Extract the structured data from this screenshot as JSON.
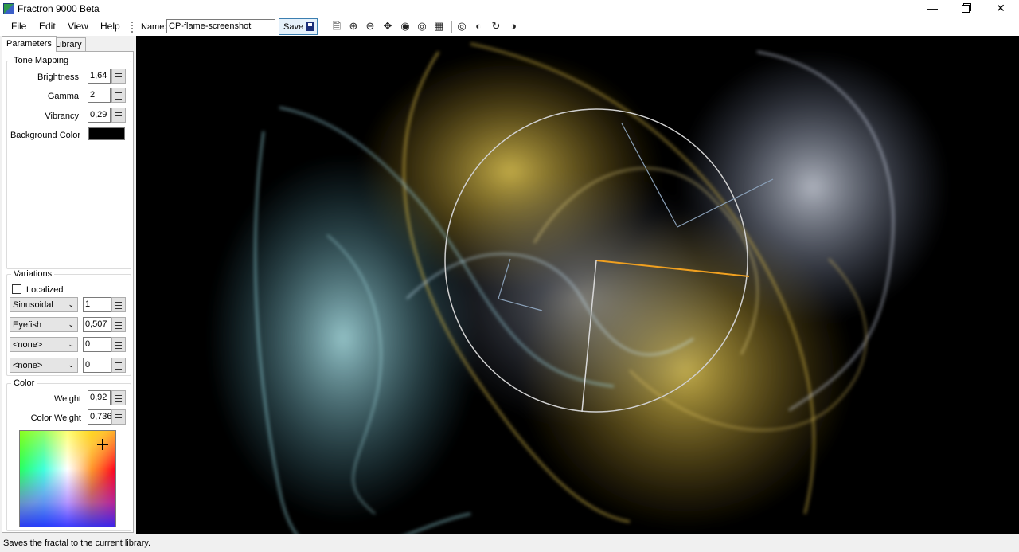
{
  "window": {
    "title": "Fractron 9000 Beta"
  },
  "menu": {
    "file": "File",
    "edit": "Edit",
    "view": "View",
    "help": "Help"
  },
  "toolbar": {
    "name_label": "Name:",
    "name_value": "CP-flame-screenshot",
    "save_label": "Save",
    "icons": [
      "new-file-icon",
      "zoom-in-icon",
      "zoom-out-icon",
      "center-icon",
      "view-icon",
      "view-alt-icon",
      "randomize-icon",
      "add-transform-icon",
      "remove-transform-icon",
      "rotate-icon",
      "copy-transform-icon"
    ]
  },
  "tabs": {
    "parameters": "Parameters",
    "library": "Library"
  },
  "tone_mapping": {
    "title": "Tone Mapping",
    "brightness_label": "Brightness",
    "brightness": "1,64",
    "gamma_label": "Gamma",
    "gamma": "2",
    "vibrancy_label": "Vibrancy",
    "vibrancy": "0,29",
    "background_label": "Background Color",
    "background_color": "#000000"
  },
  "variations": {
    "title": "Variations",
    "localized_label": "Localized",
    "localized": false,
    "rows": [
      {
        "name": "Sinusoidal",
        "value": "1"
      },
      {
        "name": "Eyefish",
        "value": "0,507"
      },
      {
        "name": "<none>",
        "value": "0"
      },
      {
        "name": "<none>",
        "value": "0"
      }
    ]
  },
  "color": {
    "title": "Color",
    "weight_label": "Weight",
    "weight": "0,92",
    "color_weight_label": "Color Weight",
    "color_weight": "0,736"
  },
  "status": {
    "text": "Saves the fractal to the current library."
  },
  "colors": {
    "accent": "#3c7fb1",
    "canvas_bg": "#000000",
    "flame_yellow": "#e8c64a",
    "flame_cyan": "#9fe8f0",
    "selected_transform": "#f0a020"
  }
}
